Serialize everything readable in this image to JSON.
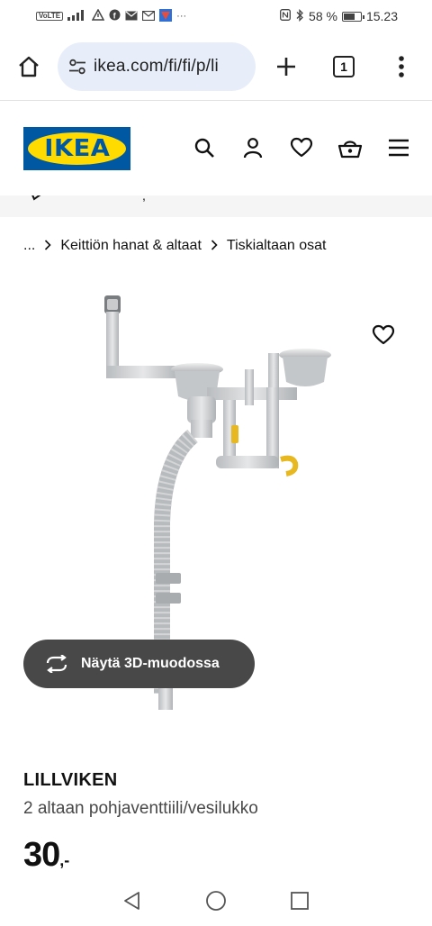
{
  "status_bar": {
    "left_icons": [
      "volte-icon",
      "signal-icon",
      "warning-icon",
      "facebook-icon",
      "mail-icon",
      "gmail-icon",
      "app-icon"
    ],
    "volte": "VoLTE",
    "more": "···",
    "battery_percent": "58 %",
    "battery_level": 0.58,
    "time": "15.23"
  },
  "browser": {
    "url": "ikea.com/fi/fi/p/li",
    "tab_count": "1"
  },
  "header": {
    "logo_text": "IKEA",
    "brand_colors": {
      "blue": "#0058a3",
      "yellow": "#ffdb00"
    }
  },
  "breadcrumb": {
    "ellipsis": "...",
    "items": [
      "Keittiön hanat & altaat",
      "Tiskialtaan osat"
    ]
  },
  "product": {
    "view_3d_label": "Näytä 3D-muodossa",
    "name": "LILLVIKEN",
    "description": "2 altaan pohjaventtiili/vesilukko",
    "price_integer": "30",
    "price_decimal": ",-"
  }
}
